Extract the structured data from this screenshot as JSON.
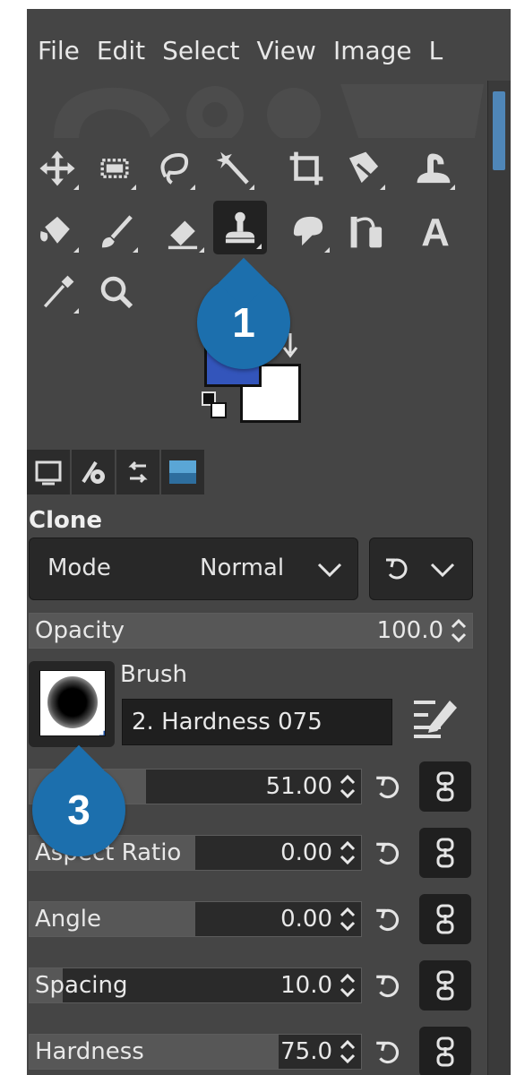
{
  "menu": [
    "File",
    "Edit",
    "Select",
    "View",
    "Image",
    "L"
  ],
  "tool_options": {
    "title": "Clone",
    "mode_label": "Mode",
    "mode_value": "Normal",
    "opacity": {
      "label": "Opacity",
      "value": "100.0",
      "fraction": 1.0
    },
    "brush_label": "Brush",
    "brush_name": "2. Hardness 075",
    "params": [
      {
        "label": "",
        "value": "51.00",
        "fraction": 0.35
      },
      {
        "label": "Aspect Ratio",
        "value": "0.00",
        "fraction": 0.5
      },
      {
        "label": "Angle",
        "value": "0.00",
        "fraction": 0.5
      },
      {
        "label": "Spacing",
        "value": "10.0",
        "fraction": 0.1
      },
      {
        "label": "Hardness",
        "value": "75.0",
        "fraction": 0.75
      }
    ]
  },
  "annotations": {
    "badge1": "1",
    "badge3": "3"
  },
  "colors": {
    "foreground": "#3355bb",
    "background": "#ffffff",
    "accent": "#1c6fad"
  },
  "icons": [
    "move-icon",
    "rect-select-icon",
    "free-select-icon",
    "fuzzy-select-icon",
    "crop-icon",
    "unified-transform-icon",
    "warp-transform-icon",
    "bucket-fill-icon",
    "paintbrush-icon",
    "eraser-icon",
    "clone-icon",
    "smudge-icon",
    "paths-icon",
    "text-icon",
    "color-picker-icon",
    "zoom-icon"
  ]
}
